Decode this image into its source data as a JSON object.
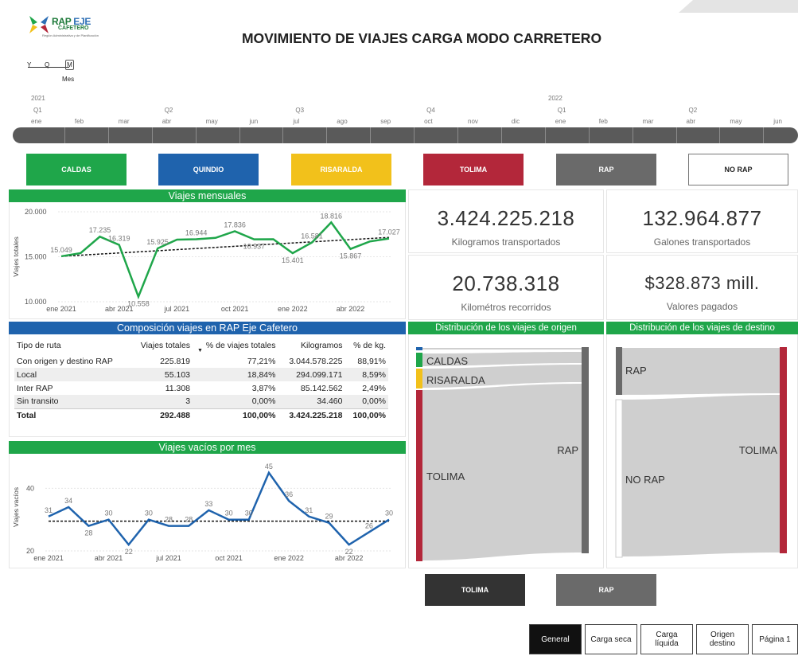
{
  "logo": {
    "brand_a": "RAP",
    "brand_b": "EJE",
    "brand_c": "CAFETERO",
    "tagline": "Región Administrativa y de Planificación"
  },
  "title": "MOVIMIENTO DE VIAJES CARGA MODO CARRETERO",
  "hierarchy": {
    "y": "Y",
    "q": "Q",
    "m": "M",
    "label": "Mes"
  },
  "timeline": {
    "years": [
      "2021",
      "2022"
    ],
    "quarters": [
      "Q1",
      "Q2",
      "Q3",
      "Q4",
      "Q1",
      "Q2"
    ],
    "months": [
      "ene",
      "feb",
      "mar",
      "abr",
      "may",
      "jun",
      "jul",
      "ago",
      "sep",
      "oct",
      "nov",
      "dic",
      "ene",
      "feb",
      "mar",
      "abr",
      "may",
      "jun"
    ]
  },
  "region_buttons": [
    {
      "label": "CALDAS",
      "color": "#1fa64a"
    },
    {
      "label": "QUINDIO",
      "color": "#1f63ad"
    },
    {
      "label": "RISARALDA",
      "color": "#f2c11b"
    },
    {
      "label": "TOLIMA",
      "color": "#b3273a"
    },
    {
      "label": "RAP",
      "color": "#6a6a6a"
    },
    {
      "label": "NO RAP",
      "color": "#ffffff"
    }
  ],
  "kpis": [
    {
      "value": "3.424.225.218",
      "label": "Kilogramos transportados"
    },
    {
      "value": "132.964.877",
      "label": "Galones transportados"
    },
    {
      "value": "20.738.318",
      "label": "Kilométros recorridos"
    },
    {
      "value": "$328.873 mill.",
      "label": "Valores pagados"
    }
  ],
  "panels": {
    "monthly": "Viajes mensuales",
    "composition": "Composición viajes en RAP Eje Cafetero",
    "empty": "Viajes vacíos por mes",
    "origin": "Distribución de los viajes de origen",
    "destination": "Distribución de los viajes de destino"
  },
  "composition_table": {
    "headers": [
      "Tipo de ruta",
      "Viajes totales",
      "% de viajes totales",
      "Kilogramos",
      "% de kg."
    ],
    "rows": [
      [
        "Con origen y destino RAP",
        "225.819",
        "77,21%",
        "3.044.578.225",
        "88,91%"
      ],
      [
        "Local",
        "55.103",
        "18,84%",
        "294.099.171",
        "8,59%"
      ],
      [
        "Inter RAP",
        "11.308",
        "3,87%",
        "85.142.562",
        "2,49%"
      ],
      [
        "Sin transito",
        "3",
        "0,00%",
        "34.460",
        "0,00%"
      ]
    ],
    "total": [
      "Total",
      "292.488",
      "100,00%",
      "3.424.225.218",
      "100,00%"
    ]
  },
  "chart_data": [
    {
      "type": "line",
      "title": "Viajes mensuales",
      "ylabel": "Viajes totales",
      "ylim": [
        10000,
        20000
      ],
      "y_ticks": [
        "20.000",
        "15.000",
        "10.000"
      ],
      "x_ticks": [
        "ene 2021",
        "abr 2021",
        "jul 2021",
        "oct 2021",
        "ene 2022",
        "abr 2022"
      ],
      "x": [
        "ene 2021",
        "feb 2021",
        "mar 2021",
        "abr 2021",
        "may 2021",
        "jun 2021",
        "jul 2021",
        "ago 2021",
        "sep 2021",
        "oct 2021",
        "nov 2021",
        "dic 2021",
        "ene 2022",
        "feb 2022",
        "mar 2022",
        "abr 2022",
        "may 2022",
        "jun 2022"
      ],
      "values": [
        15049,
        15400,
        17235,
        16319,
        10558,
        15925,
        16900,
        16944,
        17100,
        17836,
        16937,
        16950,
        15401,
        16581,
        18816,
        15867,
        16700,
        17027
      ],
      "labels": [
        "15.049",
        "",
        "17.235",
        "16.319",
        "10.558",
        "15.925",
        "",
        "16.944",
        "",
        "17.836",
        "16.937",
        "",
        "15.401",
        "16.581",
        "18.816",
        "15.867",
        "",
        "17.027"
      ],
      "trendline": [
        15050,
        17150
      ],
      "color": "#1fa64a"
    },
    {
      "type": "line",
      "title": "Viajes vacíos por mes",
      "ylabel": "Viajes vacíos",
      "ylim": [
        20,
        48
      ],
      "y_ticks": [
        "40",
        "20"
      ],
      "x_ticks": [
        "ene 2021",
        "abr 2021",
        "jul 2021",
        "oct 2021",
        "ene 2022",
        "abr 2022"
      ],
      "x": [
        "ene 2021",
        "feb 2021",
        "mar 2021",
        "abr 2021",
        "may 2021",
        "jun 2021",
        "jul 2021",
        "ago 2021",
        "sep 2021",
        "oct 2021",
        "nov 2021",
        "dic 2021",
        "ene 2022",
        "feb 2022",
        "mar 2022",
        "abr 2022",
        "may 2022",
        "jun 2022"
      ],
      "values": [
        31,
        34,
        28,
        30,
        22,
        30,
        28,
        28,
        33,
        30,
        30,
        45,
        36,
        31,
        29,
        22,
        26,
        30
      ],
      "labels": [
        "31",
        "34",
        "28",
        "30",
        "22",
        "30",
        "28",
        "28",
        "33",
        "30",
        "30",
        "45",
        "36",
        "31",
        "29",
        "22",
        "26",
        "30"
      ],
      "trendline": [
        29.5,
        29.5
      ],
      "color": "#1f63ad"
    }
  ],
  "sankey_origin": {
    "left": [
      "CALDAS",
      "RISARALDA",
      "TOLIMA"
    ],
    "right": "RAP"
  },
  "sankey_destination": {
    "left": [
      "RAP",
      "NO RAP"
    ],
    "right": "TOLIMA"
  },
  "drill_buttons": [
    {
      "label": "TOLIMA",
      "color": "#333333"
    },
    {
      "label": "RAP",
      "color": "#6a6a6a"
    }
  ],
  "nav": [
    {
      "label": "General",
      "active": true
    },
    {
      "label": "Carga seca",
      "active": false
    },
    {
      "label": "Carga líquida",
      "active": false
    },
    {
      "label": "Origen destino",
      "active": false
    },
    {
      "label": "Página 1",
      "active": false
    }
  ]
}
